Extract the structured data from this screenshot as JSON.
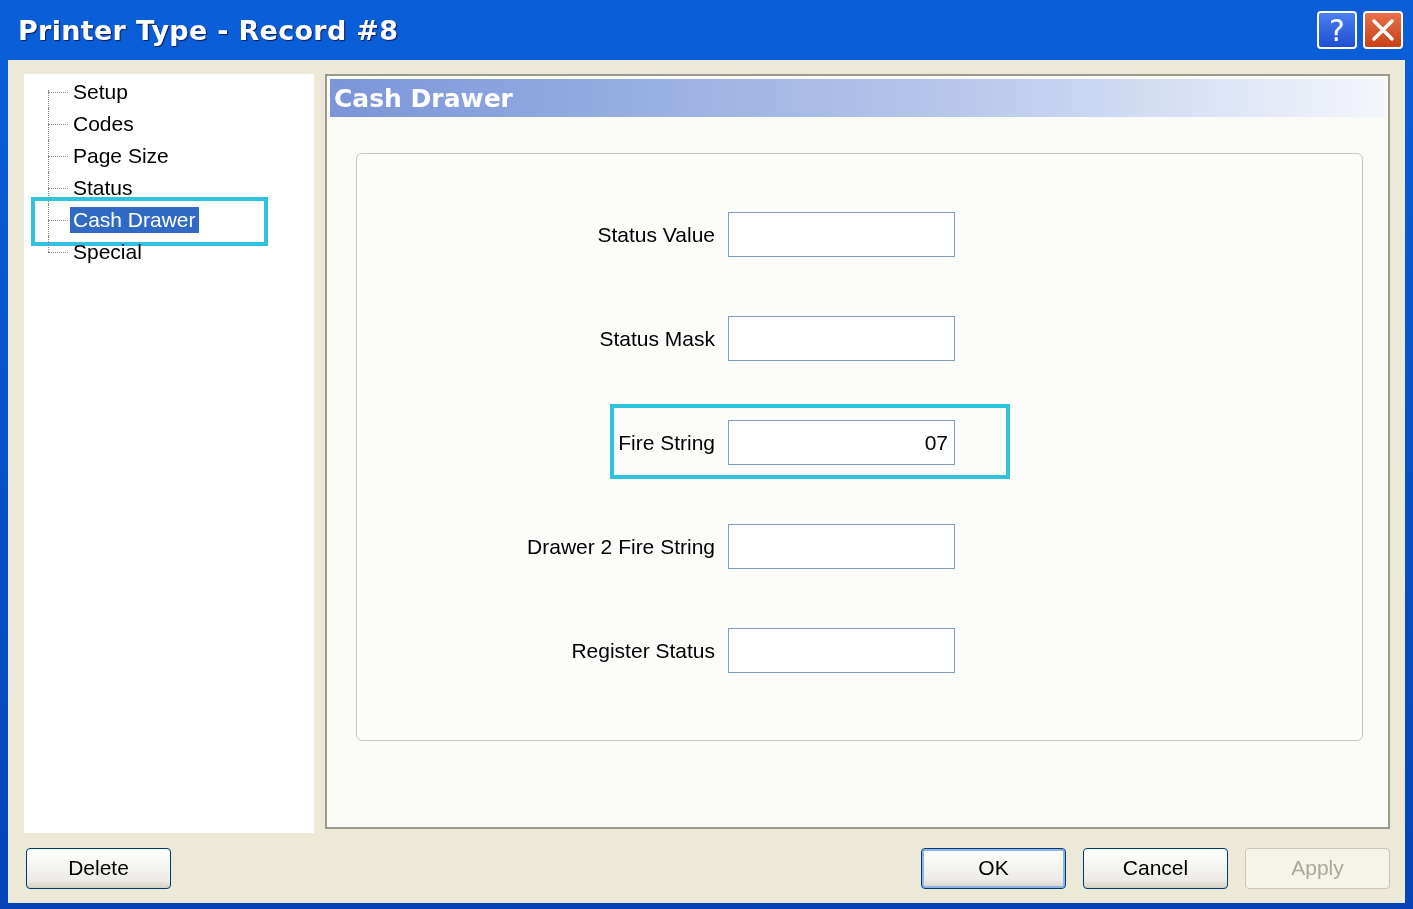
{
  "window": {
    "title": "Printer Type - Record #8",
    "help_button": "?"
  },
  "tree": [
    {
      "label": "Setup",
      "selected": false,
      "highlighted": false
    },
    {
      "label": "Codes",
      "selected": false,
      "highlighted": false
    },
    {
      "label": "Page Size",
      "selected": false,
      "highlighted": false
    },
    {
      "label": "Status",
      "selected": false,
      "highlighted": false
    },
    {
      "label": "Cash Drawer",
      "selected": true,
      "highlighted": true
    },
    {
      "label": "Special",
      "selected": false,
      "highlighted": false
    }
  ],
  "panel": {
    "title": "Cash Drawer"
  },
  "fields": [
    {
      "label": "Status Value",
      "highlighted": false
    },
    {
      "label": "Status Mask",
      "highlighted": false
    },
    {
      "label": "Fire String",
      "value": "07",
      "highlighted": true
    },
    {
      "label": "Drawer 2 Fire String",
      "highlighted": false
    },
    {
      "label": "Register Status",
      "highlighted": false
    }
  ],
  "buttons": [
    {
      "label": "Delete",
      "default": false,
      "disabled": false
    },
    {
      "label": "OK",
      "default": true,
      "disabled": false
    },
    {
      "label": "Cancel",
      "default": false,
      "disabled": false
    },
    {
      "label": "Apply",
      "default": false,
      "disabled": true
    }
  ]
}
